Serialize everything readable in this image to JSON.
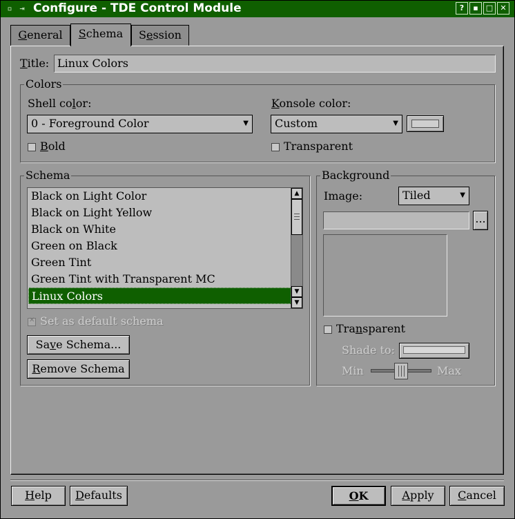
{
  "window": {
    "title": "Configure - TDE Control Module",
    "controls": [
      "?",
      "▪",
      "□",
      "✕"
    ]
  },
  "tabs": [
    {
      "pre": "",
      "u": "G",
      "post": "eneral",
      "active": false
    },
    {
      "pre": "",
      "u": "S",
      "post": "chema",
      "active": true
    },
    {
      "pre": "S",
      "u": "e",
      "post": "ssion",
      "active": false
    }
  ],
  "title_field": {
    "label_u": "T",
    "label_rest": "itle:",
    "value": "Linux Colors"
  },
  "colors": {
    "legend": "Colors",
    "shell_label_pre": "Shell co",
    "shell_label_u": "l",
    "shell_label_post": "or:",
    "shell_value": "0 - Foreground Color",
    "bold_u": "B",
    "bold_rest": "old",
    "konsole_label_u": "K",
    "konsole_label_rest": "onsole color:",
    "konsole_value": "Custom",
    "swatch_color": "#cfcfcf",
    "transparent_label": "Transparent"
  },
  "schema": {
    "legend": "Schema",
    "items": [
      "Black on Light Color",
      "Black on Light Yellow",
      "Black on White",
      "Green on Black",
      "Green Tint",
      "Green Tint with Transparent MC",
      "Linux Colors"
    ],
    "selected": "Linux Colors",
    "default_check": "Set as default schema",
    "save_pre": "Sa",
    "save_u": "v",
    "save_post": "e Schema...",
    "remove_u": "R",
    "remove_rest": "emove Schema"
  },
  "background": {
    "legend": "Background",
    "image_label": "Image:",
    "image_mode": "Tiled",
    "path_value": "",
    "browse_label": "...",
    "transparent_pre": "Tra",
    "transparent_u": "n",
    "transparent_post": "sparent",
    "shade_label": "Shade to:",
    "min_label": "Min",
    "max_label": "Max",
    "slider_fraction": 0.5
  },
  "footer": {
    "help_u": "H",
    "help_rest": "elp",
    "defaults_u": "D",
    "defaults_rest": "efaults",
    "ok_u": "O",
    "ok_rest": "K",
    "apply_u": "A",
    "apply_rest": "pply",
    "cancel_u": "C",
    "cancel_rest": "ancel"
  }
}
